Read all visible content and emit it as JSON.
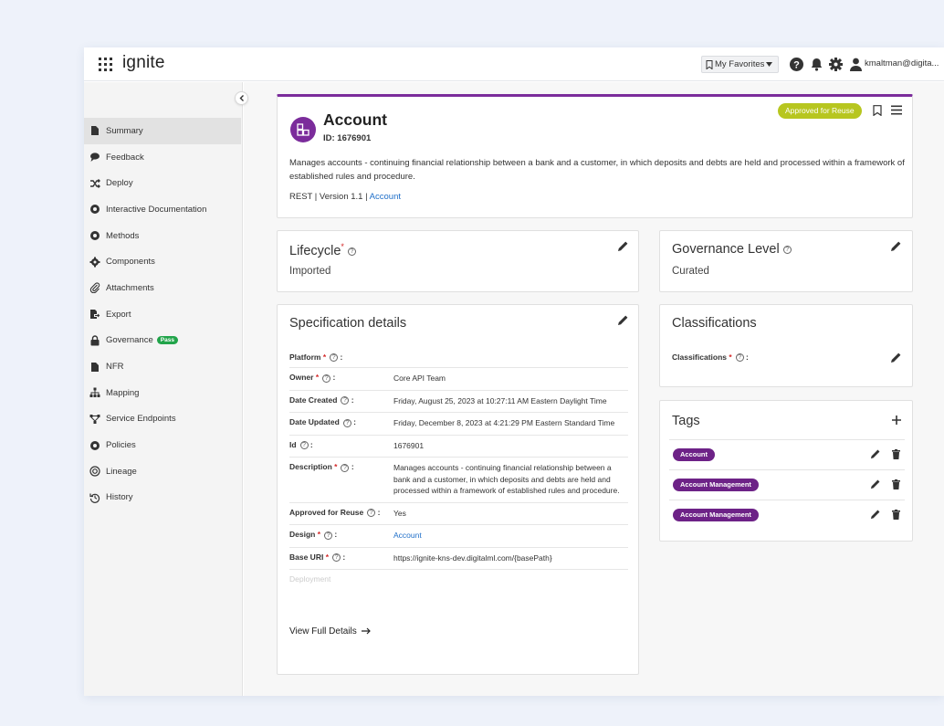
{
  "brand": "ignite",
  "topbar": {
    "favorites_label": "My Favorites",
    "user": "kmaltman@digita..."
  },
  "sidebar": {
    "items": [
      {
        "label": "Summary",
        "icon": "file-icon",
        "active": true
      },
      {
        "label": "Feedback",
        "icon": "comment-icon"
      },
      {
        "label": "Deploy",
        "icon": "shuffle-icon"
      },
      {
        "label": "Interactive Documentation",
        "icon": "circle-icon"
      },
      {
        "label": "Methods",
        "icon": "circle-icon"
      },
      {
        "label": "Components",
        "icon": "cog-icon"
      },
      {
        "label": "Attachments",
        "icon": "paperclip-icon"
      },
      {
        "label": "Export",
        "icon": "export-icon"
      },
      {
        "label": "Governance",
        "icon": "lock-icon",
        "badge": "Pass"
      },
      {
        "label": "NFR",
        "icon": "file-icon"
      },
      {
        "label": "Mapping",
        "icon": "sitemap-icon"
      },
      {
        "label": "Service Endpoints",
        "icon": "endpoint-icon"
      },
      {
        "label": "Policies",
        "icon": "circle-icon"
      },
      {
        "label": "Lineage",
        "icon": "lineage-icon"
      },
      {
        "label": "History",
        "icon": "history-icon"
      }
    ]
  },
  "account": {
    "title": "Account",
    "id_label": "ID: 1676901",
    "description": "Manages accounts - continuing financial relationship between a bank and a customer, in which deposits and debts are held and processed within a framework of established rules and procedure.",
    "meta_prefix": "REST | Version 1.1 | ",
    "meta_link": "Account",
    "badge": "Approved for Reuse"
  },
  "lifecycle": {
    "title": "Lifecycle",
    "value": "Imported"
  },
  "governance": {
    "title": "Governance Level",
    "value": "Curated"
  },
  "spec": {
    "title": "Specification details",
    "rows": [
      {
        "key": "Platform",
        "required": true,
        "value": ""
      },
      {
        "key": "Owner",
        "required": true,
        "value": "Core API Team"
      },
      {
        "key": "Date Created",
        "required": false,
        "value": "Friday, August 25, 2023 at 10:27:11 AM Eastern Daylight Time"
      },
      {
        "key": "Date Updated",
        "required": false,
        "value": "Friday, December 8, 2023 at 4:21:29 PM Eastern Standard Time"
      },
      {
        "key": "Id",
        "required": false,
        "value": "1676901"
      },
      {
        "key": "Description",
        "required": true,
        "value": "Manages accounts - continuing financial relationship between a bank and a customer, in which deposits and debts are held and processed within a framework of established rules and procedure."
      },
      {
        "key": "Approved for Reuse",
        "required": false,
        "value": "Yes"
      },
      {
        "key": "Design",
        "required": true,
        "value": "Account",
        "link": true
      },
      {
        "key": "Base URI",
        "required": true,
        "value": "https://ignite-kns-dev.digitalml.com/{basePath}"
      }
    ],
    "faded_row": "Deployment",
    "view_full": "View Full Details"
  },
  "classifications": {
    "title": "Classifications",
    "field_label": "Classifications"
  },
  "tags": {
    "title": "Tags",
    "items": [
      "Account",
      "Account Management",
      "Account Management"
    ]
  },
  "colors": {
    "accent_purple": "#7b2c9b",
    "tag_purple": "#6d2287",
    "reuse_green": "#b7c61f",
    "pass_green": "#21a44a",
    "link_blue": "#1f6fc9"
  }
}
